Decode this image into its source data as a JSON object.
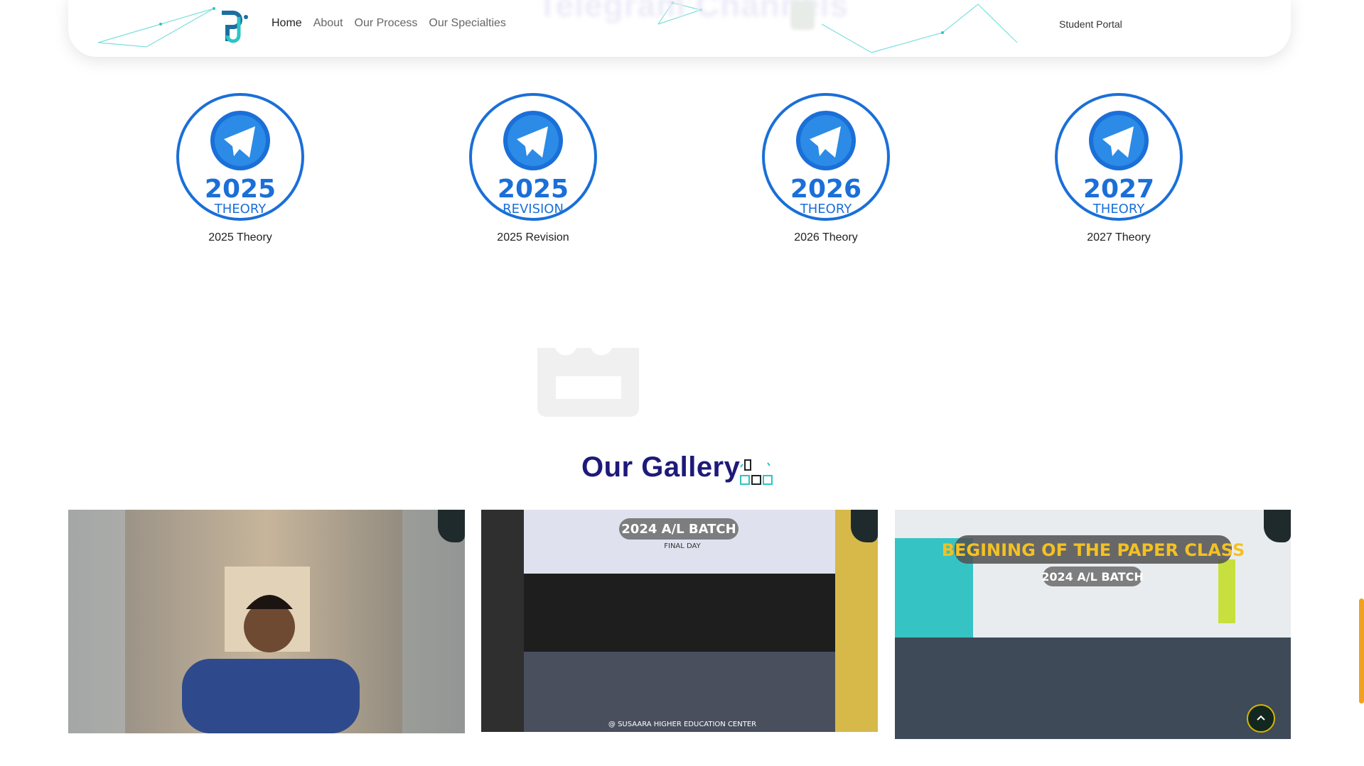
{
  "header": {
    "nav": [
      "Home",
      "About",
      "Our Process",
      "Our Specialties"
    ],
    "active": "Home",
    "portal_label": "Student Portal",
    "ghost_text": "Telegram Channels"
  },
  "channels": [
    {
      "year": "2025",
      "type": "THEORY",
      "caption": "2025 Theory"
    },
    {
      "year": "2025",
      "type": "REVISION",
      "caption": "2025 Revision"
    },
    {
      "year": "2026",
      "type": "THEORY",
      "caption": "2026 Theory"
    },
    {
      "year": "2027",
      "type": "THEORY",
      "caption": "2027 Theory"
    }
  ],
  "gallery": {
    "title": "Our Gallery",
    "images": [
      {
        "alt": "Doctor portrait in hallway",
        "overlay_title": "",
        "overlay_sub": "",
        "footer": ""
      },
      {
        "alt": "Group photo",
        "overlay_title": "2024 A/L BATCH",
        "overlay_sub": "FINAL DAY",
        "footer": "@ SUSAARA HIGHER EDUCATION CENTER"
      },
      {
        "alt": "Classroom",
        "overlay_title": "BEGINING OF THE PAPER CLASS",
        "overlay_sub": "2024 A/L BATCH",
        "footer": ""
      }
    ]
  },
  "colors": {
    "brand_blue": "#1a6fd8",
    "navy": "#1d1a7a",
    "teal": "#2ec4c4",
    "gold": "#d8b300",
    "scroll": "#f0a120"
  }
}
